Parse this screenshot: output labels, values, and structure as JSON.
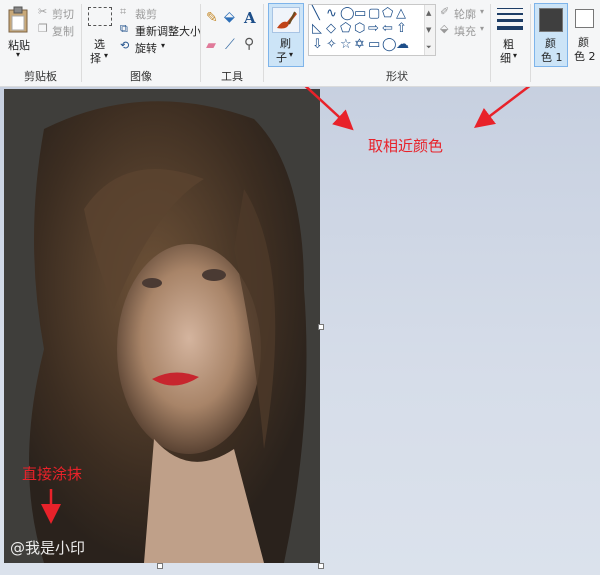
{
  "ribbon": {
    "clipboard": {
      "paste_label": "粘贴",
      "paste_arrow": "▾",
      "cut_label": "剪切",
      "copy_label": "复制",
      "group_label": "剪贴板"
    },
    "image": {
      "select_label_1": "选",
      "select_label_2": "择",
      "select_arrow": "▾",
      "crop_label": "裁剪",
      "resize_label": "重新调整大小",
      "rotate_label": "旋转",
      "rotate_arrow": "▾",
      "group_label": "图像"
    },
    "tools": {
      "group_label": "工具",
      "text_glyph": "A"
    },
    "brush": {
      "label_1": "刷",
      "label_2": "子",
      "arrow": "▾"
    },
    "shapes": {
      "outline_label": "轮廓",
      "fill_label": "填充",
      "outline_arrow": "▾",
      "fill_arrow": "▾",
      "group_label": "形状"
    },
    "size": {
      "label_1": "粗",
      "label_2": "细",
      "arrow": "▾"
    },
    "color1": {
      "label_1": "颜",
      "label_2": "色 1"
    },
    "color2": {
      "label_1": "颜",
      "label_2": "色 2"
    }
  },
  "annotations": {
    "pick_color": "取相近颜色",
    "smear": "直接涂抹",
    "watermark": "@我是小印"
  },
  "colors": {
    "annotation": "#e8222a",
    "color1": "#3f3f3f",
    "color2": "#ffffff",
    "accent": "#1d4e89"
  }
}
